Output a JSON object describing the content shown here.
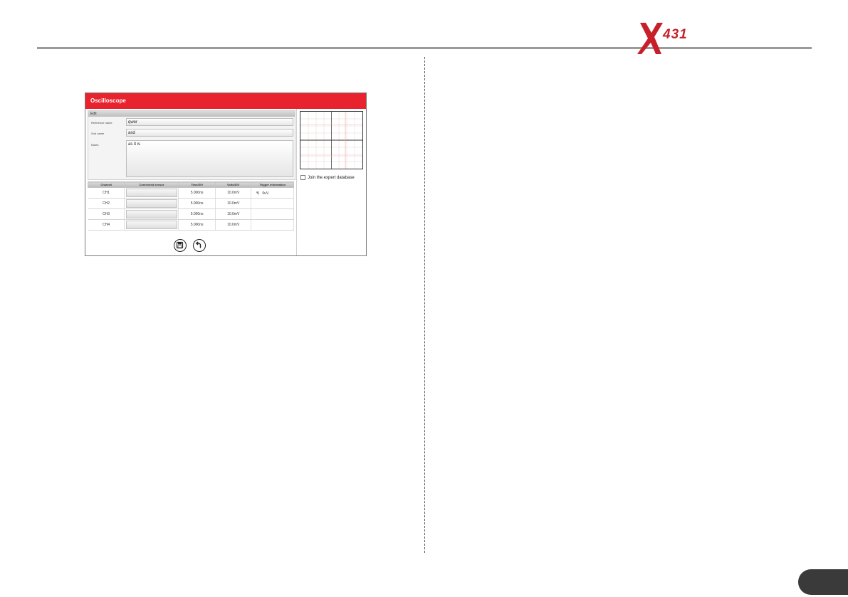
{
  "brand": {
    "logo_text": "X-431",
    "logo_digits": "431",
    "accent_color": "#e8232e"
  },
  "window": {
    "title": "Oscilloscope",
    "edit": {
      "header": "Edit",
      "reference_label": "Reference name",
      "reference_value": "qwer",
      "subname_label": "Sub name",
      "subname_value": "asd",
      "notes_label": "Notes",
      "notes_value": "as it is"
    },
    "table": {
      "columns": [
        "Channel",
        "Connected sensor",
        "Time/DIV",
        "Volts/DIV",
        "Trigger information"
      ],
      "rows": [
        {
          "channel": "CH1",
          "sensor": "",
          "time_div": "5.000ns",
          "volts_div": "10.0mV",
          "trigger": "0uV"
        },
        {
          "channel": "CH2",
          "sensor": "",
          "time_div": "5.000ns",
          "volts_div": "10.0mV",
          "trigger": ""
        },
        {
          "channel": "CH3",
          "sensor": "",
          "time_div": "5.000ns",
          "volts_div": "10.0mV",
          "trigger": ""
        },
        {
          "channel": "CH4",
          "sensor": "",
          "time_div": "5.000ns",
          "volts_div": "10.0mV",
          "trigger": ""
        }
      ]
    },
    "expert_checkbox_label": "Join the expert database",
    "expert_checked": false,
    "icons": {
      "save": "save-icon",
      "back": "back-arrow-icon",
      "trigger": "trigger-edge-icon"
    }
  }
}
